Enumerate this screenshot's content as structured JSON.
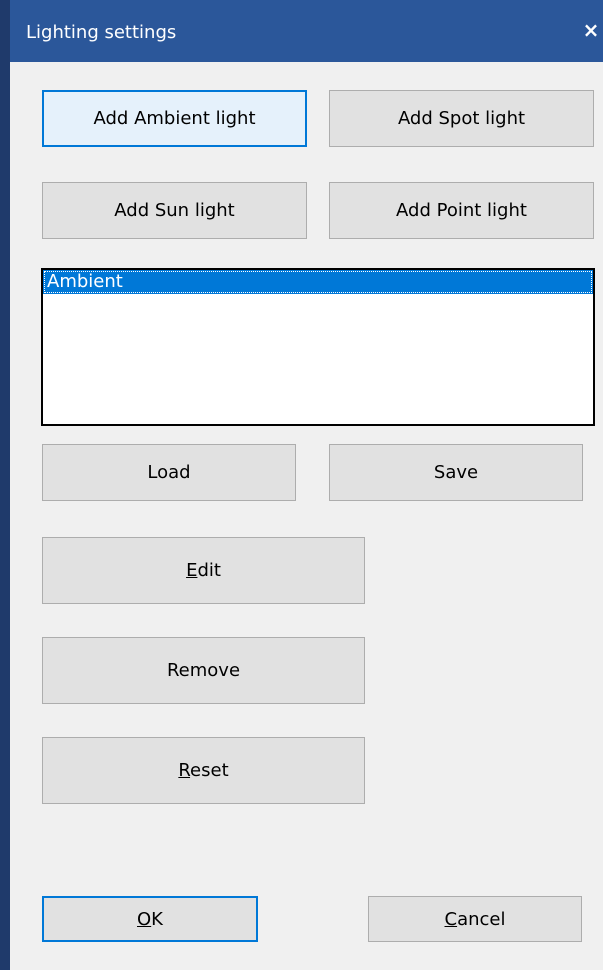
{
  "window": {
    "title": "Lighting settings",
    "close_glyph": "×",
    "titlebar_color": "#2b579a",
    "accent": "#0078d7"
  },
  "buttons": {
    "add_ambient": "Add Ambient light",
    "add_spot": "Add Spot light",
    "add_sun": "Add Sun light",
    "add_point": "Add Point light",
    "load": "Load",
    "save": "Save",
    "edit_mnemonic": "E",
    "edit_rest": "dit",
    "remove": "Remove",
    "reset_mnemonic": "R",
    "reset_rest": "eset",
    "ok_mnemonic": "O",
    "ok_rest": "K",
    "cancel_mnemonic": "C",
    "cancel_rest": "ancel"
  },
  "lights_list": {
    "items": [
      {
        "label": "Ambient",
        "selected": true
      }
    ]
  }
}
